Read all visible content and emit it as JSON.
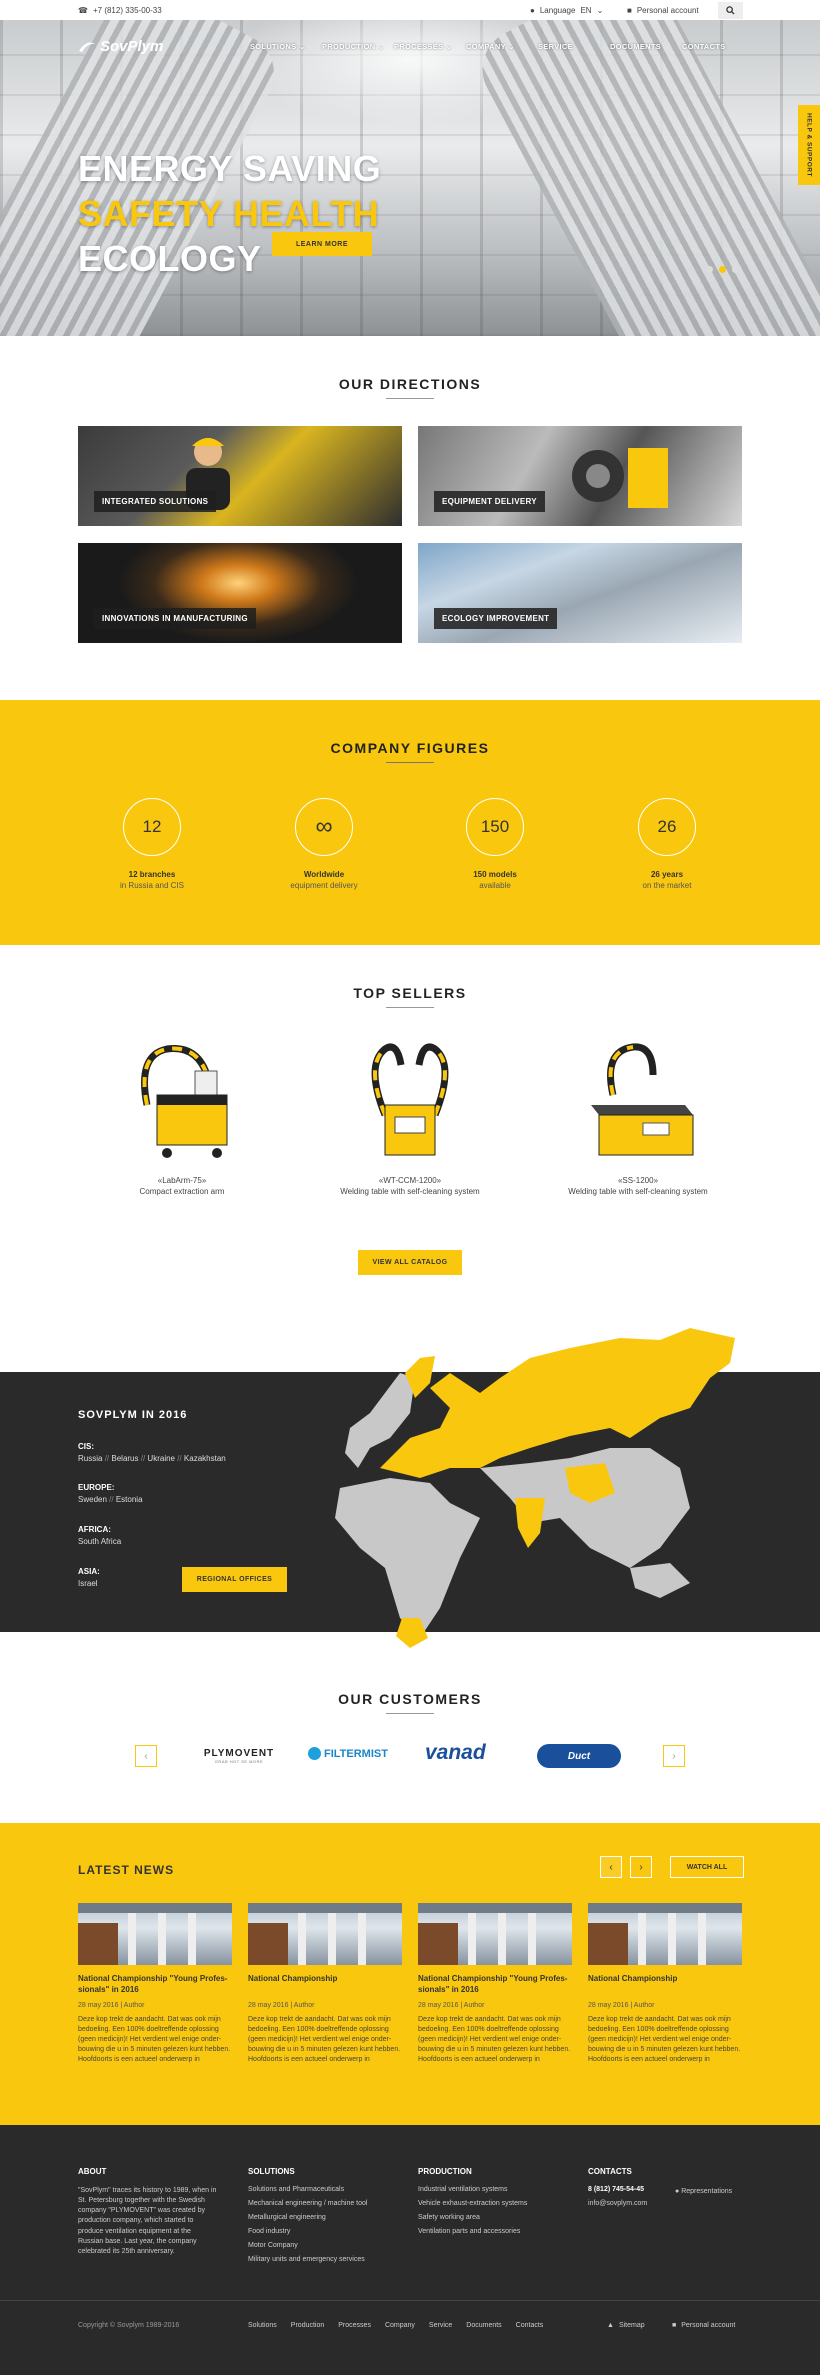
{
  "topbar": {
    "phone": "+7 (812) 335-00-33",
    "language_label": "Language",
    "language_value": "EN",
    "account_label": "Personal account"
  },
  "header": {
    "logo": "SovPlym",
    "nav": [
      "Solutions",
      "Production",
      "Processes",
      "Company",
      "Service",
      "Documents",
      "Contacts"
    ]
  },
  "hero": {
    "line1": "ENERGY SAVING",
    "line2": "SAFETY HEALTH",
    "line3": "ECOLOGY",
    "cta": "LEARN MORE",
    "help_tab": "HELP & SUPPORT",
    "accent": "#f9c80e"
  },
  "directions": {
    "title": "OUR DIRECTIONS",
    "items": [
      "INTEGRATED SOLUTIONS",
      "EQUIPMENT DELIVERY",
      "INNOVATIONS IN MANUFACTURING",
      "ECOLOGY IMPROVEMENT"
    ]
  },
  "figures": {
    "title": "COMPANY FIGURES",
    "items": [
      {
        "value": "12",
        "line1": "12 branches",
        "line2": "in Russia and CIS"
      },
      {
        "value": "∞",
        "line1": "Worldwide",
        "line2": "equipment delivery"
      },
      {
        "value": "150",
        "line1": "150 models",
        "line2": "available"
      },
      {
        "value": "26",
        "line1": "26 years",
        "line2": "on the market"
      }
    ]
  },
  "top_sellers": {
    "title": "TOP SELLERS",
    "items": [
      {
        "name": "«LabArm-75»",
        "desc": "Compact extraction arm"
      },
      {
        "name": "«WT-CCM-1200»",
        "desc": "Welding table with self-cleaning system"
      },
      {
        "name": "«SS-1200»",
        "desc": "Welding table with self-cleaning system"
      }
    ],
    "cta": "VIEW ALL CATALOG"
  },
  "presence": {
    "title": "SOVPLYM IN 2016",
    "regions": [
      {
        "name": "CIS:",
        "countries": [
          "Russia",
          "Belarus",
          "Ukraine",
          "Kazakhstan"
        ]
      },
      {
        "name": "EUROPE:",
        "countries": [
          "Sweden",
          "Estonia"
        ]
      },
      {
        "name": "AFRICA:",
        "countries": [
          "South Africa"
        ]
      },
      {
        "name": "ASIA:",
        "countries": [
          "Israel"
        ]
      }
    ],
    "cta": "REGIONAL OFFICES",
    "separator": "//"
  },
  "customers": {
    "title": "OUR CUSTOMERS",
    "logos": [
      "PLYMOVENT",
      "FILTERMIST",
      "vanad",
      "Duct"
    ],
    "plymovent_tagline": "GRAB HOT SE MORE"
  },
  "news": {
    "title": "LATEST NEWS",
    "cta": "WATCH ALL",
    "items": [
      {
        "title": "National Championship \"Young Profes-sionals\" in 2016",
        "meta": "28 may 2016 | Author",
        "excerpt": "Deze kop trekt de aandacht. Dat was ook mijn bedoeling. Een 100% doeltreffende oplossing (geen medicijn)! Het verdient wel enige onder-bouwing die u in 5 minuten gelezen kunt hebben. Hoofdoorts is een actueel onderwerp in"
      },
      {
        "title": "National Championship",
        "meta": "28 may 2016 | Author",
        "excerpt": "Deze kop trekt de aandacht. Dat was ook mijn bedoeling. Een 100% doeltreffende oplossing (geen medicijn)! Het verdient wel enige onder-bouwing die u in 5 minuten gelezen kunt hebben. Hoofdoorts is een actueel onderwerp in"
      },
      {
        "title": "National Championship \"Young Profes-sionals\" in 2016",
        "meta": "28 may 2016 | Author",
        "excerpt": "Deze kop trekt de aandacht. Dat was ook mijn bedoeling. Een 100% doeltreffende oplossing (geen medicijn)! Het verdient wel enige onder-bouwing die u in 5 minuten gelezen kunt hebben. Hoofdoorts is een actueel onderwerp in"
      },
      {
        "title": "National Championship",
        "meta": "28 may 2016 | Author",
        "excerpt": "Deze kop trekt de aandacht. Dat was ook mijn bedoeling. Een 100% doeltreffende oplossing (geen medicijn)! Het verdient wel enige onder-bouwing die u in 5 minuten gelezen kunt hebben. Hoofdoorts is een actueel onderwerp in"
      }
    ]
  },
  "footer": {
    "about": {
      "title": "ABOUT",
      "text": "\"SovPlym\" traces its history to 1989, when in St. Petersburg together with the Swedish company \"PLYMOVENT\" was created by production company, which started to produce ventilation equipment at the Russian base. Last year, the company celebrated its 25th anniversary."
    },
    "solutions": {
      "title": "SOLUTIONS",
      "items": [
        "Solutions and Pharmaceuticals",
        "Mechanical engineering / machine tool",
        "Metallurgical engineering",
        "Food industry",
        "Motor Company",
        "Military units and emergency services"
      ]
    },
    "production": {
      "title": "PRODUCTION",
      "items": [
        "Industrial ventilation systems",
        "Vehicle exhaust-extraction systems",
        "Safety working area",
        "Ventilation parts and accessories"
      ]
    },
    "contacts": {
      "title": "CONTACTS",
      "phone": "8 (812) 745-54-45",
      "email": "info@sovplym.com",
      "representations": "Representations"
    },
    "copyright": "Copyright © Sovplym 1989-2016",
    "bottom_links": [
      "Solutions",
      "Production",
      "Processes",
      "Company",
      "Service",
      "Documents",
      "Contacts"
    ],
    "sitemap": "Sitemap",
    "account": "Personal account"
  }
}
